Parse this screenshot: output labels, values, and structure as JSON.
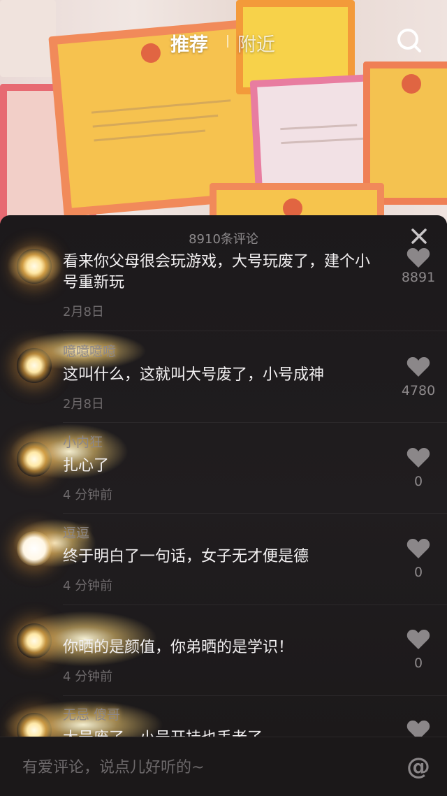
{
  "nav": {
    "tab_recommend": "推荐",
    "tab_nearby": "附近"
  },
  "comments_panel": {
    "title": "8910条评论",
    "input_placeholder": "有爱评论，说点儿好听的~",
    "comments": [
      {
        "username": "",
        "text": "看来你父母很会玩游戏，大号玩废了，建个小号重新玩",
        "time": "2月8日",
        "likes": "8891"
      },
      {
        "username": "噫噫噫噫",
        "text": "这叫什么，这就叫大号废了，小号成神",
        "time": "2月8日",
        "likes": "4780"
      },
      {
        "username": "小内狂",
        "text": "扎心了",
        "time": "4 分钟前",
        "likes": "0"
      },
      {
        "username": "逗逗",
        "text": "终于明白了一句话，女子无才便是德",
        "time": "4 分钟前",
        "likes": "0"
      },
      {
        "username": "",
        "text": "你晒的是颜值，你弟晒的是学识！",
        "time": "4 分钟前",
        "likes": "0"
      },
      {
        "username": "无忌 傻哥",
        "text": "大号废了，小号开挂也丢老了",
        "time": "",
        "likes": ""
      }
    ]
  },
  "colors": {
    "panel_bg": "#1c191b",
    "text_primary": "#f1eff0",
    "text_muted": "#6f6b6d"
  }
}
